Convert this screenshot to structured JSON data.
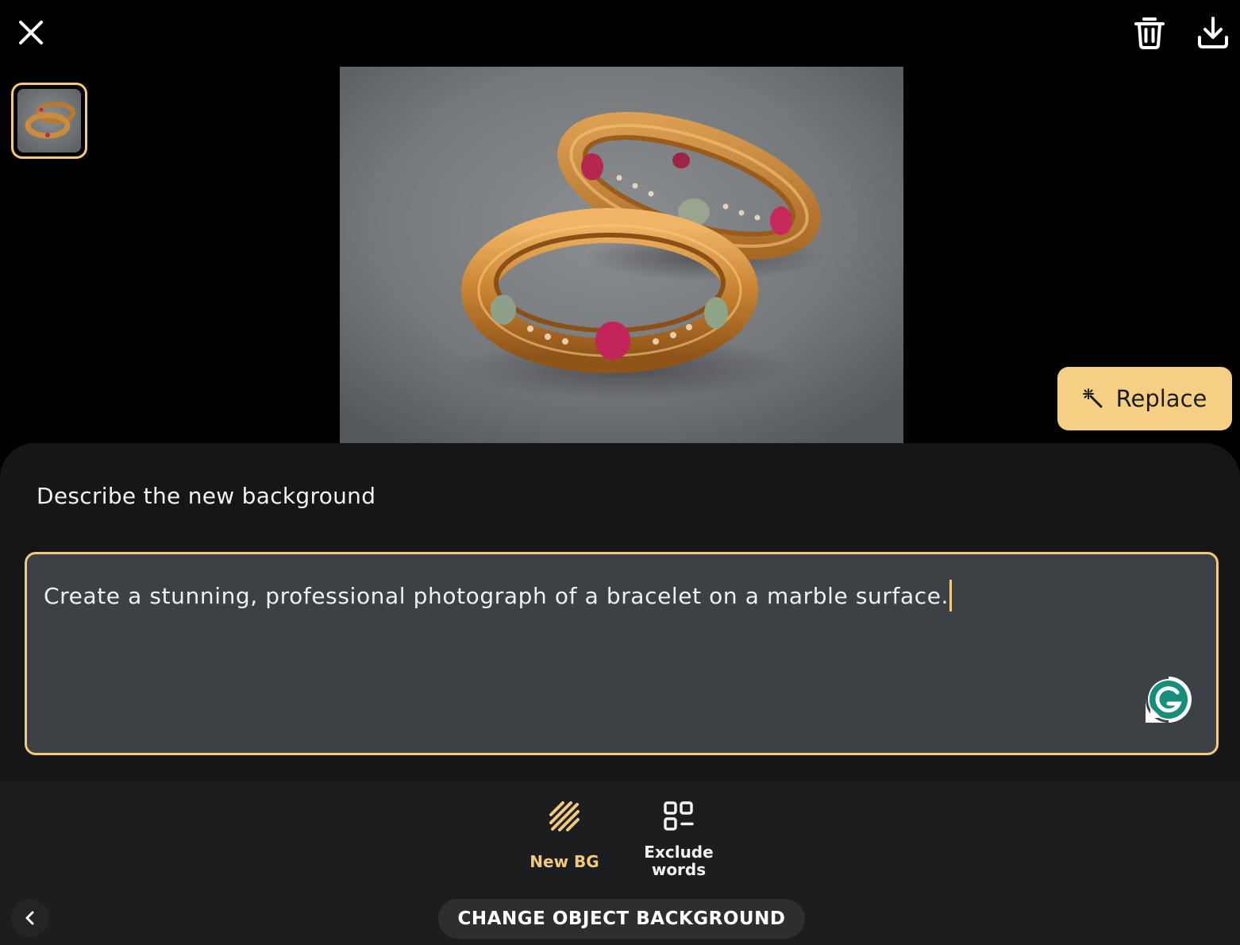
{
  "toolbar": {
    "close_icon": "close-icon",
    "delete_icon": "trash-icon",
    "download_icon": "download-icon"
  },
  "editor": {
    "replace_label": "Replace",
    "replace_icon": "magic-wand-icon",
    "panel_title": "Describe the new background",
    "prompt_value": "Create a stunning, professional photograph of a bracelet on a marble surface."
  },
  "tools": {
    "new_bg_label": "New BG",
    "exclude_label_line1": "Exclude",
    "exclude_label_line2": "words"
  },
  "footer": {
    "mode_label": "CHANGE OBJECT BACKGROUND"
  },
  "colors": {
    "accent": "#f3c97a",
    "replace_button": "#f5cf84",
    "panel_bg": "#151616",
    "input_bg": "#3c4145"
  }
}
